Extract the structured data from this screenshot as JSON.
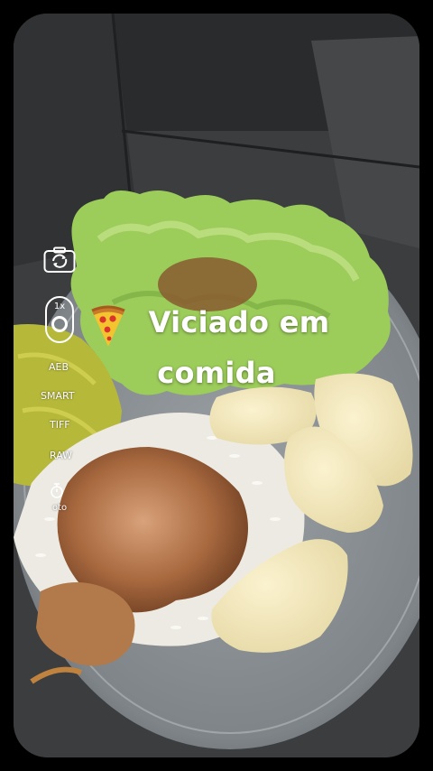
{
  "camera": {
    "flip_icon": "camera-flip-icon",
    "zoom_label": "1x",
    "options": [
      "AEB",
      "SMART",
      "TIFF",
      "RAW"
    ],
    "timer_icon": "timer-icon",
    "photo_label": "oto"
  },
  "caption": {
    "line1": "Viciado em",
    "line2": "comida",
    "emoji_icon": "pizza-icon"
  }
}
